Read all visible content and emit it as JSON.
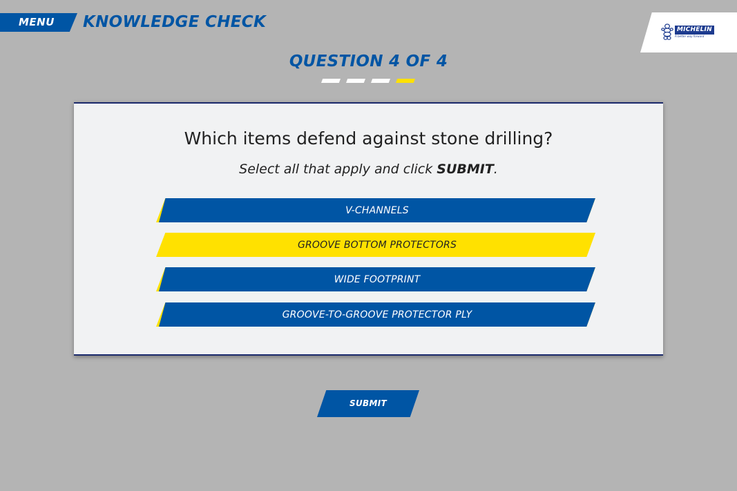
{
  "header": {
    "menu_label": "MENU",
    "section_title": "KNOWLEDGE CHECK"
  },
  "logo": {
    "brand": "MICHELIN",
    "tagline": "A better way forward",
    "icon": "michelin-man-icon"
  },
  "question": {
    "counter": "QUESTION 4 OF 4",
    "current": 4,
    "total": 4,
    "text": "Which items defend against stone drilling?",
    "instruction_prefix": "Select all that apply and click ",
    "instruction_action": "SUBMIT",
    "instruction_suffix": "."
  },
  "answers": [
    {
      "label": "V-CHANNELS",
      "selected": false
    },
    {
      "label": "GROOVE BOTTOM PROTECTORS",
      "selected": true
    },
    {
      "label": "WIDE FOOTPRINT",
      "selected": false
    },
    {
      "label": "GROOVE-TO-GROOVE PROTECTOR PLY",
      "selected": false
    }
  ],
  "submit_label": "SUBMIT",
  "colors": {
    "background": "#b4b4b4",
    "brand_blue": "#0055a4",
    "accent_yellow": "#ffe100",
    "card": "#f1f2f3",
    "logo_blue": "#1d3b8f"
  }
}
